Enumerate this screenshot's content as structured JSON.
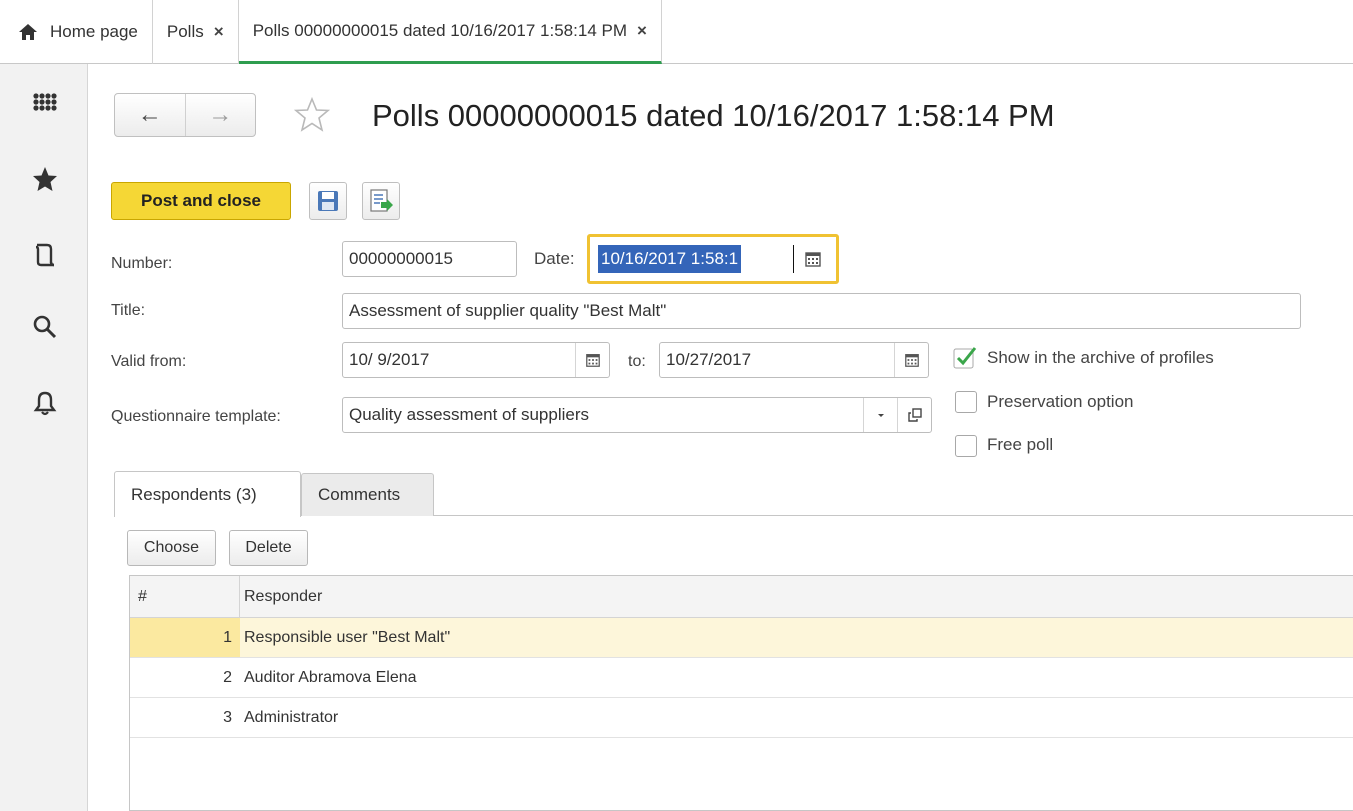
{
  "tabs": {
    "home": "Home page",
    "polls": "Polls",
    "doc": "Polls 00000000015 dated 10/16/2017 1:58:14 PM",
    "close_glyph": "×"
  },
  "sidebar": {
    "icons": [
      "apps-grid-icon",
      "favorites-star-icon",
      "history-icon",
      "search-icon",
      "notifications-bell-icon"
    ]
  },
  "header": {
    "back_glyph": "←",
    "forward_glyph": "→",
    "title": "Polls 00000000015 dated 10/16/2017 1:58:14 PM"
  },
  "toolbar": {
    "post_and_close": "Post and close"
  },
  "form": {
    "number_label": "Number:",
    "number_value": "00000000015",
    "date_label": "Date:",
    "date_value": "10/16/2017  1:58:1",
    "title_label": "Title:",
    "title_value": "Assessment of supplier quality \"Best Malt\"",
    "valid_from_label": "Valid from:",
    "valid_from_value": "10/ 9/2017",
    "to_label": "to:",
    "to_value": "10/27/2017",
    "template_label": "Questionnaire template:",
    "template_value": "Quality assessment of suppliers",
    "show_in_archive_label": "Show in the archive of profiles",
    "show_in_archive_checked": true,
    "preservation_label": "Preservation option",
    "preservation_checked": false,
    "free_poll_label": "Free poll",
    "free_poll_checked": false
  },
  "form_tabs": {
    "respondents": "Respondents (3)",
    "comments": "Comments"
  },
  "grid_toolbar": {
    "choose": "Choose",
    "delete": "Delete"
  },
  "grid": {
    "columns": [
      "#",
      "Responder"
    ],
    "rows": [
      {
        "num": "1",
        "responder": "Responsible user \"Best Malt\""
      },
      {
        "num": "2",
        "responder": "Auditor Abramova Elena"
      },
      {
        "num": "3",
        "responder": "Administrator"
      }
    ]
  },
  "colors": {
    "accent_green": "#2e9d4f",
    "post_button_yellow": "#f5d735",
    "focus_yellow": "#f0c232",
    "selection_blue": "#3465b9",
    "checkmark_green": "#3aa64a"
  }
}
